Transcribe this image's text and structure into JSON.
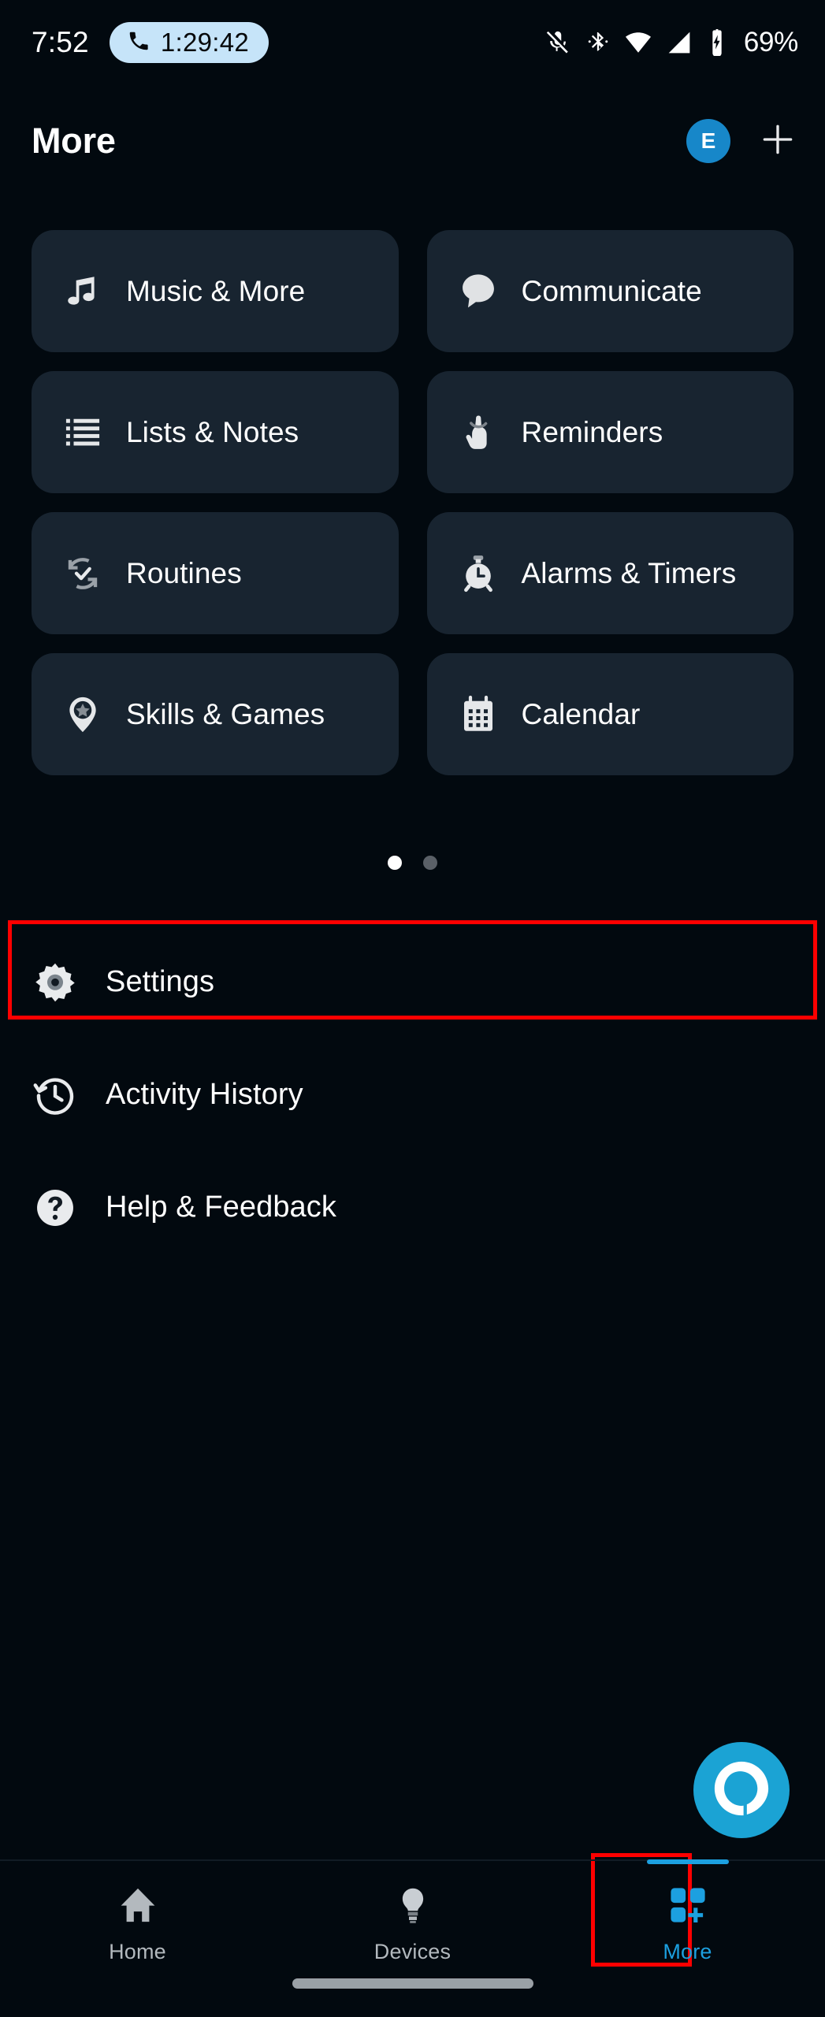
{
  "status_bar": {
    "clock": "7:52",
    "call_timer": "1:29:42",
    "call_icon": "phone-icon",
    "mic_icon": "microphone-muted-icon",
    "bluetooth_icon": "bluetooth-icon",
    "wifi_icon": "wifi-icon",
    "signal_icon": "cellular-signal-icon",
    "battery_icon": "battery-charging-icon",
    "battery_percent": "69%",
    "pill_color": "#c6e4f9"
  },
  "header": {
    "title": "More",
    "avatar_initial": "E",
    "avatar_color": "#1787c9",
    "add_icon": "plus-icon"
  },
  "grid": {
    "cards": [
      {
        "label": "Music & More",
        "icon": "music-note-icon"
      },
      {
        "label": "Communicate",
        "icon": "speech-bubble-icon"
      },
      {
        "label": "Lists & Notes",
        "icon": "list-icon"
      },
      {
        "label": "Reminders",
        "icon": "finger-string-icon"
      },
      {
        "label": "Routines",
        "icon": "refresh-check-icon"
      },
      {
        "label": "Alarms & Timers",
        "icon": "alarm-clock-icon"
      },
      {
        "label": "Skills & Games",
        "icon": "star-pin-icon"
      },
      {
        "label": "Calendar",
        "icon": "calendar-icon"
      }
    ],
    "card_color": "#182430"
  },
  "pager": {
    "total": 2,
    "active_index": 0
  },
  "list": {
    "rows": [
      {
        "label": "Settings",
        "icon": "gear-icon"
      },
      {
        "label": "Activity History",
        "icon": "clock-rewind-icon"
      },
      {
        "label": "Help & Feedback",
        "icon": "question-mark-circle-icon"
      }
    ]
  },
  "annotations": {
    "highlight_color": "#ff0000",
    "targets": [
      "settings-row",
      "more-tab"
    ]
  },
  "fab": {
    "icon": "alexa-icon",
    "color": "#1ba3d4"
  },
  "bottom_nav": {
    "items": [
      {
        "label": "Home",
        "icon": "home-icon",
        "active": false
      },
      {
        "label": "Devices",
        "icon": "bulb-icon",
        "active": false
      },
      {
        "label": "More",
        "icon": "grid-plus-icon",
        "active": true
      }
    ],
    "active_color": "#1ca0e0",
    "inactive_color": "#b3b9be"
  }
}
